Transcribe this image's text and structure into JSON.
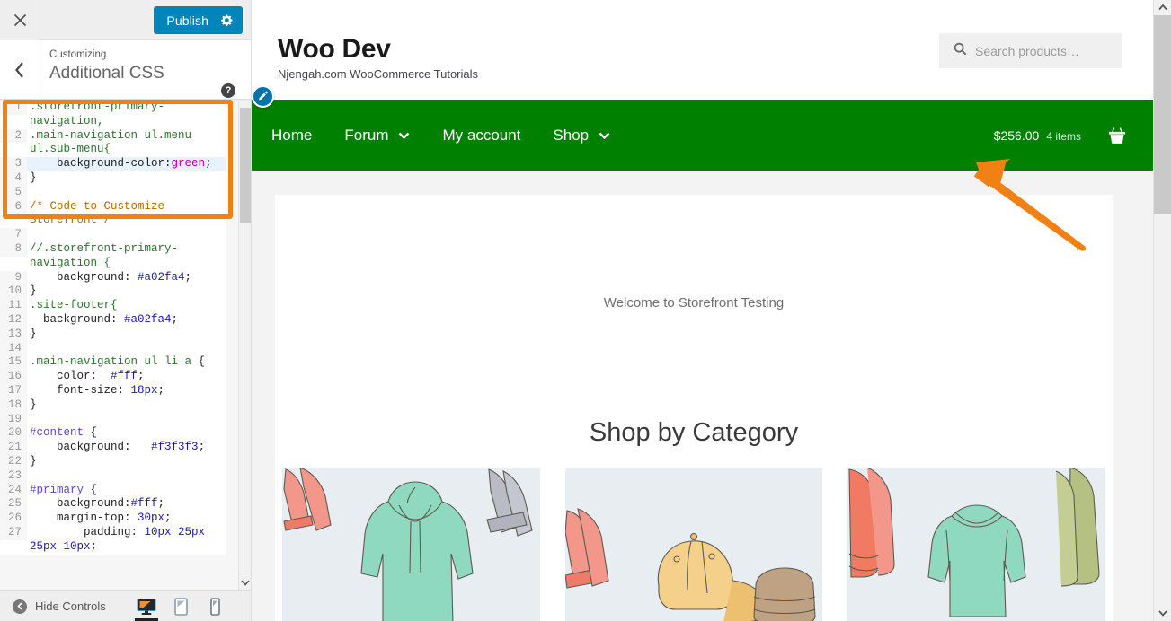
{
  "customizer": {
    "close_label": "×",
    "publish_label": "Publish",
    "gear_icon": "gear-icon",
    "back_icon": "chevron-left-icon",
    "breadcrumb": "Customizing",
    "panel_title": "Additional CSS",
    "help_label": "?",
    "hide_controls_label": "Hide Controls",
    "devices": [
      {
        "name": "desktop",
        "label": "Desktop",
        "active": true
      },
      {
        "name": "tablet",
        "label": "Tablet",
        "active": false
      },
      {
        "name": "mobile",
        "label": "Mobile",
        "active": false
      }
    ],
    "code_lines": [
      {
        "n": "1",
        "active": false,
        "tokens": [
          {
            "t": ".storefront-primary-navigation,",
            "c": "tok-sel"
          }
        ]
      },
      {
        "n": "2",
        "active": false,
        "tokens": [
          {
            "t": ".main-navigation ",
            "c": "tok-sel"
          },
          {
            "t": "ul",
            "c": "tok-tag"
          },
          {
            "t": ".menu ",
            "c": "tok-sel"
          },
          {
            "t": "ul",
            "c": "tok-tag"
          },
          {
            "t": ".sub-menu{",
            "c": "tok-sel"
          }
        ]
      },
      {
        "n": "3",
        "active": true,
        "tokens": [
          {
            "t": "    background-color:",
            "c": "tok-prop"
          },
          {
            "t": "green",
            "c": "tok-kw"
          },
          {
            "t": ";",
            "c": "tok-punct"
          }
        ]
      },
      {
        "n": "4",
        "active": false,
        "tokens": [
          {
            "t": "}",
            "c": "tok-punct"
          }
        ]
      },
      {
        "n": "5",
        "active": false,
        "tokens": [
          {
            "t": "",
            "c": "tok-punct"
          }
        ]
      },
      {
        "n": "6",
        "active": false,
        "tokens": [
          {
            "t": "/* Code to Customize Storefront*/",
            "c": "tok-cmt"
          }
        ]
      },
      {
        "n": "7",
        "active": false,
        "tokens": [
          {
            "t": "",
            "c": "tok-punct"
          }
        ]
      },
      {
        "n": "8",
        "active": false,
        "tokens": [
          {
            "t": "//.storefront-primary-navigation {",
            "c": "tok-sel"
          }
        ]
      },
      {
        "n": "9",
        "active": false,
        "tokens": [
          {
            "t": "    background: ",
            "c": "tok-prop"
          },
          {
            "t": "#a02fa4",
            "c": "tok-num"
          },
          {
            "t": ";",
            "c": "tok-punct"
          }
        ]
      },
      {
        "n": "10",
        "active": false,
        "tokens": [
          {
            "t": "}",
            "c": "tok-punct"
          }
        ]
      },
      {
        "n": "11",
        "active": false,
        "tokens": [
          {
            "t": ".site-footer{",
            "c": "tok-sel"
          }
        ]
      },
      {
        "n": "12",
        "active": false,
        "tokens": [
          {
            "t": "  background: ",
            "c": "tok-prop"
          },
          {
            "t": "#a02fa4",
            "c": "tok-num"
          },
          {
            "t": ";",
            "c": "tok-punct"
          }
        ]
      },
      {
        "n": "13",
        "active": false,
        "tokens": [
          {
            "t": "}",
            "c": "tok-punct"
          }
        ]
      },
      {
        "n": "14",
        "active": false,
        "tokens": [
          {
            "t": "",
            "c": "tok-punct"
          }
        ]
      },
      {
        "n": "15",
        "active": false,
        "tokens": [
          {
            "t": ".main-navigation ",
            "c": "tok-sel"
          },
          {
            "t": "ul li a",
            "c": "tok-tag"
          },
          {
            "t": " {",
            "c": "tok-punct"
          }
        ]
      },
      {
        "n": "16",
        "active": false,
        "tokens": [
          {
            "t": "    color:  ",
            "c": "tok-prop"
          },
          {
            "t": "#fff",
            "c": "tok-num"
          },
          {
            "t": ";",
            "c": "tok-punct"
          }
        ]
      },
      {
        "n": "17",
        "active": false,
        "tokens": [
          {
            "t": "    font-size: ",
            "c": "tok-prop"
          },
          {
            "t": "18px",
            "c": "tok-num"
          },
          {
            "t": ";",
            "c": "tok-punct"
          }
        ]
      },
      {
        "n": "18",
        "active": false,
        "tokens": [
          {
            "t": "}",
            "c": "tok-punct"
          }
        ]
      },
      {
        "n": "19",
        "active": false,
        "tokens": [
          {
            "t": "",
            "c": "tok-punct"
          }
        ]
      },
      {
        "n": "20",
        "active": false,
        "tokens": [
          {
            "t": "#content",
            "c": "tok-id"
          },
          {
            "t": " {",
            "c": "tok-punct"
          }
        ]
      },
      {
        "n": "21",
        "active": false,
        "tokens": [
          {
            "t": "    background:   ",
            "c": "tok-prop"
          },
          {
            "t": "#f3f3f3",
            "c": "tok-num"
          },
          {
            "t": ";",
            "c": "tok-punct"
          }
        ]
      },
      {
        "n": "22",
        "active": false,
        "tokens": [
          {
            "t": "}",
            "c": "tok-punct"
          }
        ]
      },
      {
        "n": "23",
        "active": false,
        "tokens": [
          {
            "t": "",
            "c": "tok-punct"
          }
        ]
      },
      {
        "n": "24",
        "active": false,
        "tokens": [
          {
            "t": "#primary",
            "c": "tok-id"
          },
          {
            "t": " {",
            "c": "tok-punct"
          }
        ]
      },
      {
        "n": "25",
        "active": false,
        "tokens": [
          {
            "t": "    background:",
            "c": "tok-prop"
          },
          {
            "t": "#fff",
            "c": "tok-num"
          },
          {
            "t": ";",
            "c": "tok-punct"
          }
        ]
      },
      {
        "n": "26",
        "active": false,
        "tokens": [
          {
            "t": "    margin-top: ",
            "c": "tok-prop"
          },
          {
            "t": "30px",
            "c": "tok-num"
          },
          {
            "t": ";",
            "c": "tok-punct"
          }
        ]
      },
      {
        "n": "27",
        "active": false,
        "tokens": [
          {
            "t": "        padding: ",
            "c": "tok-prop"
          },
          {
            "t": "10px 25px 25px 10px",
            "c": "tok-num"
          },
          {
            "t": ";",
            "c": "tok-punct"
          }
        ]
      }
    ]
  },
  "preview": {
    "site_title": "Woo Dev",
    "tagline": "Njengah.com WooCommerce Tutorials",
    "search_placeholder": "Search products…",
    "search_icon": "search-icon",
    "edit_icon": "pencil-edit-icon",
    "nav": [
      {
        "label": "Home",
        "has_dropdown": false
      },
      {
        "label": "Forum",
        "has_dropdown": true
      },
      {
        "label": "My account",
        "has_dropdown": false
      },
      {
        "label": "Shop",
        "has_dropdown": true
      }
    ],
    "cart": {
      "amount": "$256.00",
      "count": "4 items",
      "icon": "shopping-basket-icon"
    },
    "welcome_text": "Welcome to Storefront Testing",
    "shop_by_category_heading": "Shop by Category",
    "categories": [
      {
        "name": "hoodies"
      },
      {
        "name": "caps-and-hats"
      },
      {
        "name": "tshirts-and-sweaters"
      }
    ],
    "nav_background_color": "#008000",
    "accent_color": "#0085ba",
    "annotation_arrow_color": "#F28114"
  }
}
